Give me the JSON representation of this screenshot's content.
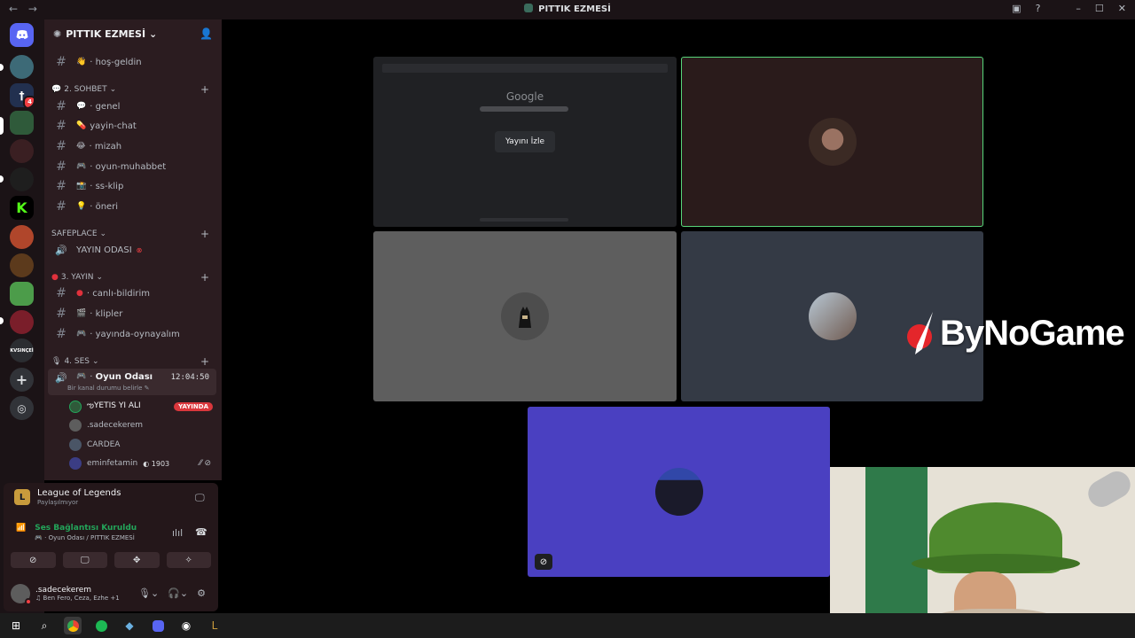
{
  "window": {
    "title": "PITTIK EZMESİ"
  },
  "server": {
    "name": "PITTIK EZMESİ",
    "rail_label_kvsinci": "KVSINÇEİ"
  },
  "channels": {
    "welcome": "hoş-geldin",
    "categories": {
      "sohbet": "2. SOHBET",
      "safeplace": "SAFEPLACE",
      "yayin": "3. YAYIN",
      "ses": "4. SES"
    },
    "sohbet": [
      "genel",
      "yayin-chat",
      "mizah",
      "oyun-muhabbet",
      "ss-klip",
      "öneri"
    ],
    "safeplace_voice": "YAYIN ODASI",
    "yayin": [
      "canlı-bildirim",
      "klipler",
      "yayında-oynayalım"
    ],
    "voice_channel": {
      "name": "Oyun Odası",
      "timer": "12:04:50",
      "status_hint": "Bir kanal durumu belirle"
    },
    "members": [
      {
        "name": "ఌYETIS YI ALI",
        "live": "YAYINDA"
      },
      {
        "name": ".sadecekerem"
      },
      {
        "name": "CARDEA"
      },
      {
        "name": "eminfetamin",
        "tag": "1903"
      }
    ]
  },
  "activity": {
    "game": "League of Legends",
    "status": "Paylaşılmıyor"
  },
  "voice_status": {
    "title": "Ses Bağlantısı Kuruldu",
    "location": "Oyun Odası / PITTIK EZMESİ"
  },
  "user": {
    "name": ".sadecekerem",
    "status": "Ben Fero, Ceza, Ezhe +1"
  },
  "stream": {
    "google_text": "Google",
    "watch_button": "Yayını İzle"
  },
  "watermark": "ByNoGame",
  "colors": {
    "accent_green": "#57d67a",
    "live_red": "#da373c",
    "sidebar_bg": "#2b1c20",
    "blurple_tile": "#4a40c1"
  }
}
